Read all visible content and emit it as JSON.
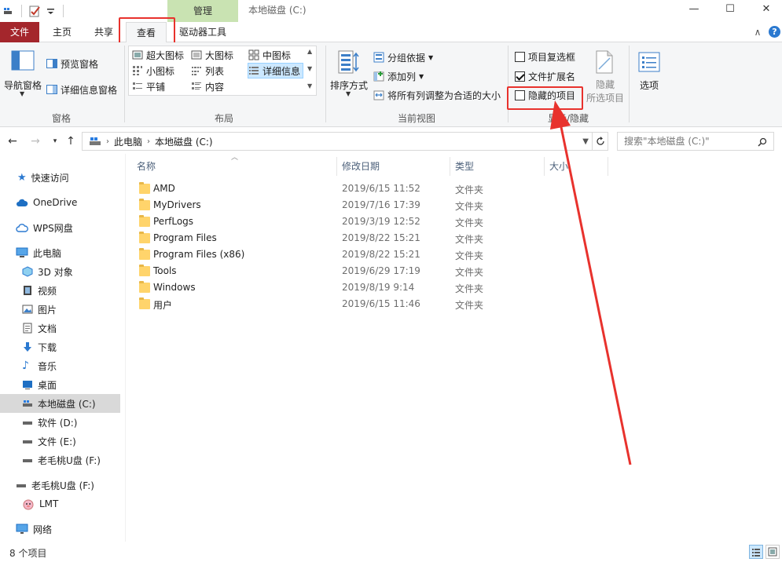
{
  "title_bar": {
    "context_tab": "管理",
    "window_title": "本地磁盘 (C:)",
    "minimize": "—",
    "maximize": "☐",
    "close": "✕"
  },
  "tabs": {
    "file": "文件",
    "home": "主页",
    "share": "共享",
    "view": "查看",
    "drive_tools": "驱动器工具",
    "collapse": "∧",
    "help": "?"
  },
  "ribbon": {
    "panes": {
      "nav_pane": "导航窗格",
      "preview": "预览窗格",
      "details": "详细信息窗格",
      "group_label": "窗格"
    },
    "layout": {
      "extra_large": "超大图标",
      "large": "大图标",
      "medium": "中图标",
      "small": "小图标",
      "list": "列表",
      "details": "详细信息",
      "tiles": "平铺",
      "content": "内容",
      "group_label": "布局"
    },
    "current_view": {
      "sort_by": "排序方式",
      "group_by": "分组依据",
      "add_columns": "添加列",
      "size_all_columns": "将所有列调整为合适的大小",
      "group_label": "当前视图"
    },
    "show_hide": {
      "item_checkboxes": "项目复选框",
      "item_checkboxes_checked": false,
      "file_extensions": "文件扩展名",
      "file_extensions_checked": true,
      "hidden_items": "隐藏的项目",
      "hidden_items_checked": false,
      "hide_selected_line1": "隐藏",
      "hide_selected_line2": "所选项目",
      "group_label": "显示/隐藏"
    },
    "options": "选项"
  },
  "address": {
    "path": [
      "此电脑",
      "本地磁盘 (C:)"
    ],
    "search_placeholder": "搜索\"本地磁盘 (C:)\""
  },
  "nav_pane": {
    "items": [
      {
        "label": "快速访问",
        "icon": "star-icon"
      },
      {
        "label": "OneDrive",
        "icon": "cloud-icon"
      },
      {
        "label": "WPS网盘",
        "icon": "wps-cloud-icon"
      },
      {
        "label": "此电脑",
        "icon": "computer-icon"
      },
      {
        "label": "3D 对象",
        "icon": "3d-objects-icon"
      },
      {
        "label": "视频",
        "icon": "video-icon"
      },
      {
        "label": "图片",
        "icon": "pictures-icon"
      },
      {
        "label": "文档",
        "icon": "documents-icon"
      },
      {
        "label": "下载",
        "icon": "download-icon"
      },
      {
        "label": "音乐",
        "icon": "music-icon"
      },
      {
        "label": "桌面",
        "icon": "desktop-icon"
      },
      {
        "label": "本地磁盘 (C:)",
        "icon": "drive-icon"
      },
      {
        "label": "软件 (D:)",
        "icon": "drive-icon"
      },
      {
        "label": "文件 (E:)",
        "icon": "drive-icon"
      },
      {
        "label": "老毛桃U盘 (F:)",
        "icon": "usb-drive-icon"
      },
      {
        "label": "老毛桃U盘 (F:)",
        "icon": "usb-drive-icon"
      },
      {
        "label": "LMT",
        "icon": "lmt-icon"
      },
      {
        "label": "网络",
        "icon": "network-icon"
      }
    ]
  },
  "columns": {
    "name": "名称",
    "date": "修改日期",
    "type": "类型",
    "size": "大小"
  },
  "files": [
    {
      "name": "AMD",
      "date": "2019/6/15 11:52",
      "type": "文件夹"
    },
    {
      "name": "MyDrivers",
      "date": "2019/7/16 17:39",
      "type": "文件夹"
    },
    {
      "name": "PerfLogs",
      "date": "2019/3/19 12:52",
      "type": "文件夹"
    },
    {
      "name": "Program Files",
      "date": "2019/8/22 15:21",
      "type": "文件夹"
    },
    {
      "name": "Program Files (x86)",
      "date": "2019/8/22 15:21",
      "type": "文件夹"
    },
    {
      "name": "Tools",
      "date": "2019/6/29 17:19",
      "type": "文件夹"
    },
    {
      "name": "Windows",
      "date": "2019/8/19 9:14",
      "type": "文件夹"
    },
    {
      "name": "用户",
      "date": "2019/6/15 11:46",
      "type": "文件夹"
    }
  ],
  "status": {
    "count": "8 个项目"
  },
  "colors": {
    "file_tab": "#a4262c",
    "annotation": "#e8322d",
    "context_tab": "#c9e3b2"
  }
}
